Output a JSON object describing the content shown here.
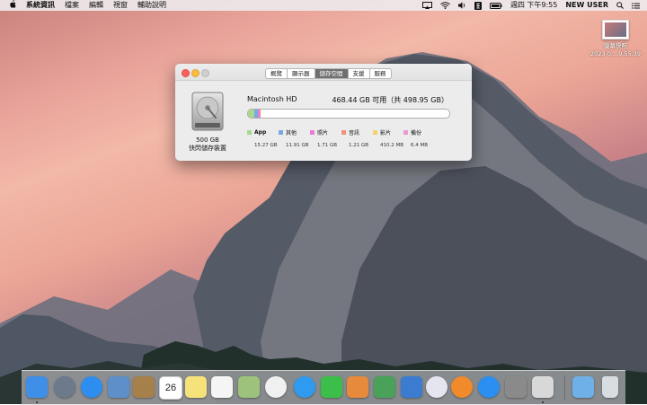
{
  "menubar": {
    "apple": "",
    "items": [
      "系統資訊",
      "檔案",
      "編輯",
      "視窗",
      "輔助說明"
    ],
    "clock": "週四 下午9:55",
    "user": "NEW USER"
  },
  "desktop_file": {
    "label_line1": "螢幕快照",
    "label_line2": "2023-0....9.55.39"
  },
  "about_window": {
    "tabs": [
      "概覽",
      "顯示器",
      "儲存空間",
      "支援",
      "服務"
    ],
    "active_tab": "儲存空間",
    "disk": {
      "size": "500 GB",
      "kind": "快閃儲存裝置"
    },
    "volume": {
      "name": "Macintosh HD",
      "available": "468.44 GB 可用（共 498.95 GB）",
      "usage_fraction": 0.061
    },
    "legend": [
      {
        "name": "App",
        "size": "15.27 GB",
        "color": "#a6d98a"
      },
      {
        "name": "其他",
        "size": "11.91 GB",
        "color": "#7aa8e6"
      },
      {
        "name": "照片",
        "size": "1.71 GB",
        "color": "#e97bd8"
      },
      {
        "name": "音訊",
        "size": "1.21 GB",
        "color": "#f2907a"
      },
      {
        "name": "影片",
        "size": "410.2 MB",
        "color": "#f3d36b"
      },
      {
        "name": "備份",
        "size": "6.4 MB",
        "color": "#e99ad7"
      }
    ]
  },
  "dock": {
    "apps": [
      {
        "name": "finder",
        "color": "#3f8fe8",
        "running": true
      },
      {
        "name": "launchpad",
        "color": "#6c7a8c",
        "running": false
      },
      {
        "name": "safari",
        "color": "#2d8ef0",
        "running": false
      },
      {
        "name": "preview",
        "color": "#5f8fc9",
        "running": false
      },
      {
        "name": "contacts",
        "color": "#a5804a",
        "running": false
      },
      {
        "name": "calendar",
        "color": "#ffffff",
        "running": false
      },
      {
        "name": "notes",
        "color": "#f6e27a",
        "running": false
      },
      {
        "name": "reminders",
        "color": "#f5f5f5",
        "running": false
      },
      {
        "name": "photo-booth",
        "color": "#9cc27c",
        "running": false
      },
      {
        "name": "photos",
        "color": "#f0f0f0",
        "running": false
      },
      {
        "name": "messages",
        "color": "#2e9bf0",
        "running": false
      },
      {
        "name": "facetime",
        "color": "#3bbf4a",
        "running": false
      },
      {
        "name": "ibooks-author",
        "color": "#e88a3c",
        "running": false
      },
      {
        "name": "numbers",
        "color": "#4aa15a",
        "running": false
      },
      {
        "name": "keynote",
        "color": "#3b7bd0",
        "running": false
      },
      {
        "name": "itunes",
        "color": "#e5e5ef",
        "running": false
      },
      {
        "name": "ibooks",
        "color": "#f08a2a",
        "running": false
      },
      {
        "name": "app-store",
        "color": "#2a8ff0",
        "running": false
      },
      {
        "name": "system-preferences",
        "color": "#8a8a8a",
        "running": false
      },
      {
        "name": "system-information",
        "color": "#d8d8d8",
        "running": true
      },
      {
        "name": "downloads-folder",
        "color": "#6fb0e8",
        "running": false
      },
      {
        "name": "trash",
        "color": "#d8dde2",
        "running": false
      }
    ],
    "calendar_day": "26"
  }
}
